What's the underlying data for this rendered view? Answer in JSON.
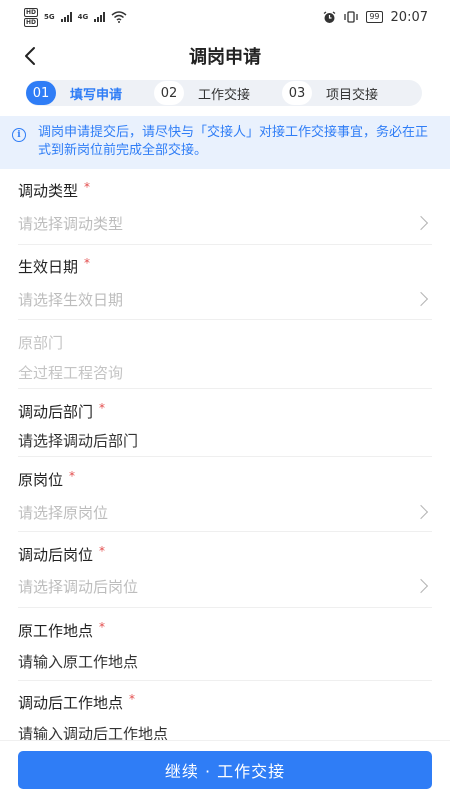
{
  "status_bar": {
    "hd_top": "HD",
    "hd_bottom": "HD",
    "net_type": "5G",
    "net_type2": "4G",
    "battery": "99",
    "time": "20:07"
  },
  "nav": {
    "title": "调岗申请",
    "back_icon": "chevron-left-icon"
  },
  "steps": [
    {
      "num": "01",
      "label": "填写申请",
      "active": true
    },
    {
      "num": "02",
      "label": "工作交接",
      "active": false
    },
    {
      "num": "03",
      "label": "项目交接",
      "active": false
    }
  ],
  "notice": {
    "icon": "info-icon",
    "icon_glyph": "i",
    "text": "调岗申请提交后，请尽快与「交接人」对接工作交接事宜，务必在正式到新岗位前完成全部交接。"
  },
  "form": {
    "fields": [
      {
        "label": "调动类型",
        "required": true,
        "value": "请选择调动类型",
        "has_arrow": true
      },
      {
        "label": "生效日期",
        "required": true,
        "value": "请选择生效日期",
        "has_arrow": true
      },
      {
        "label": "原部门",
        "required": false,
        "value": "全过程工程咨询",
        "disabled": true
      },
      {
        "label": "调动后部门",
        "required": true,
        "value": "请选择调动后部门",
        "has_arrow": false
      },
      {
        "label": "原岗位",
        "required": true,
        "value": "请选择原岗位",
        "has_arrow": true
      },
      {
        "label": "调动后岗位",
        "required": true,
        "value": "请选择调动后岗位",
        "has_arrow": true
      },
      {
        "label": "原工作地点",
        "required": true,
        "value": "请输入原工作地点",
        "has_arrow": false
      },
      {
        "label": "调动后工作地点",
        "required": true,
        "value": "请输入调动后工作地点",
        "has_arrow": false
      }
    ],
    "required_mark": "*"
  },
  "footer": {
    "button_label": "继续 · 工作交接"
  },
  "colors": {
    "accent": "#2f7df6",
    "notice_bg": "#e9f1fd",
    "required": "#e34d4d",
    "placeholder": "#bdbdbd"
  }
}
